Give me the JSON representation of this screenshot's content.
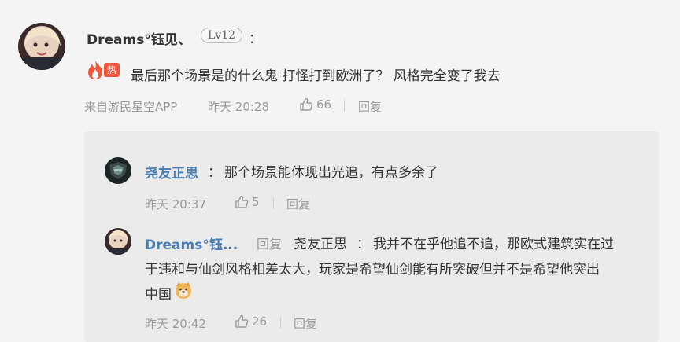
{
  "comment": {
    "username": "Dreams°钰见、",
    "level": "Lv12",
    "colon": "：",
    "hot_badge": "热",
    "text": "最后那个场景是的什么鬼 打怪打到欧洲了？ 风格完全变了我去",
    "source": "来自游民星空APP",
    "time": "昨天 20:28",
    "likes": "66",
    "reply_label": "回复"
  },
  "replies": [
    {
      "username": "尧友正思",
      "colon": "：",
      "text": "那个场景能体现出光追，有点多余了",
      "time": "昨天 20:37",
      "likes": "5",
      "reply_label": "回复"
    },
    {
      "username": "Dreams°钰...",
      "reply_word": "回复",
      "reply_to": "尧友正思",
      "colon": "：",
      "text_line1": "我并不在乎他追不追，那欧式建筑实在过",
      "text_line2": "于违和与仙剑风格相差太大，玩家是希望仙剑能有所突破但并不是希望他突出",
      "text_line3": "中国",
      "time": "昨天 20:42",
      "likes": "26",
      "reply_label": "回复"
    }
  ],
  "icons": {
    "flame": "flame-icon",
    "thumb": "thumbs-up-icon",
    "emoji": "doge-emoji-icon"
  },
  "colors": {
    "background": "#f4f4f4",
    "panel": "#ebebeb",
    "reply_username": "#4a7bb1",
    "hot": "#f0553d",
    "meta": "#9a9a9a"
  }
}
